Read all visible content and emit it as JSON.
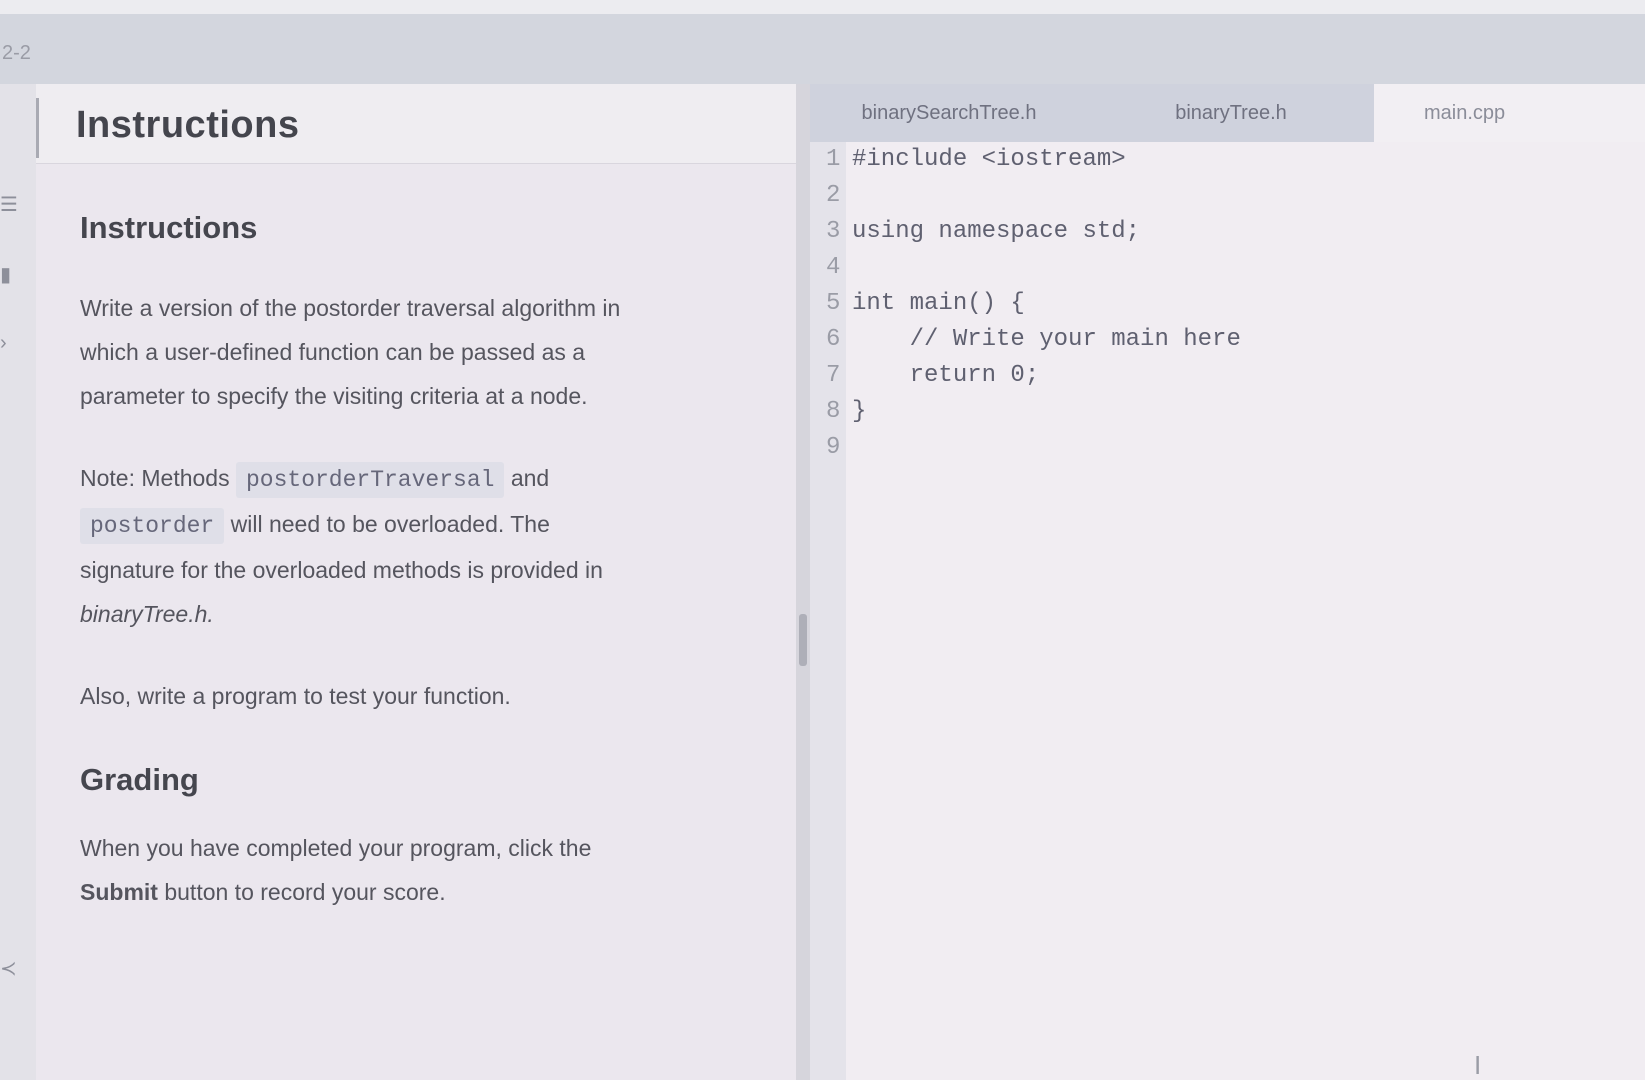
{
  "header": {
    "label": "2-2"
  },
  "rail": {
    "icons": [
      "menu-icon",
      "bookmark-icon",
      "code-icon",
      "share-icon"
    ]
  },
  "instructions_panel": {
    "header_title": "Instructions",
    "section_title": "Instructions",
    "paragraph1": [
      "Write a version of the postorder traversal algorithm in",
      "which a user-defined function can be passed as a",
      "parameter to specify the visiting criteria at a node."
    ],
    "note": {
      "prefix": "Note: Methods",
      "code1": "postorderTraversal",
      "and": "and",
      "code2": "postorder",
      "line2_rest": "will need to be overloaded. The",
      "line3": "signature for the overloaded methods is provided in",
      "line4": "binaryTree.h."
    },
    "paragraph2": "Also, write a program to test your function.",
    "grading_title": "Grading",
    "grading": {
      "line1": "When you have completed your program, click the",
      "submit_label": "Submit",
      "line2_rest": "button to record your score."
    }
  },
  "editor": {
    "tabs": [
      {
        "label": "binarySearchTree.h",
        "active": false
      },
      {
        "label": "binaryTree.h",
        "active": false
      },
      {
        "label": "main.cpp",
        "active": true
      }
    ],
    "lines": [
      {
        "n": "1",
        "code": "#include <iostream>"
      },
      {
        "n": "2",
        "code": ""
      },
      {
        "n": "3",
        "code": "using namespace std;"
      },
      {
        "n": "4",
        "code": ""
      },
      {
        "n": "5",
        "code": "int main() {"
      },
      {
        "n": "6",
        "code": "    // Write your main here"
      },
      {
        "n": "7",
        "code": "    return 0;"
      },
      {
        "n": "8",
        "code": "}"
      },
      {
        "n": "9",
        "code": ""
      }
    ]
  },
  "cursor": {
    "glyph": "I"
  }
}
